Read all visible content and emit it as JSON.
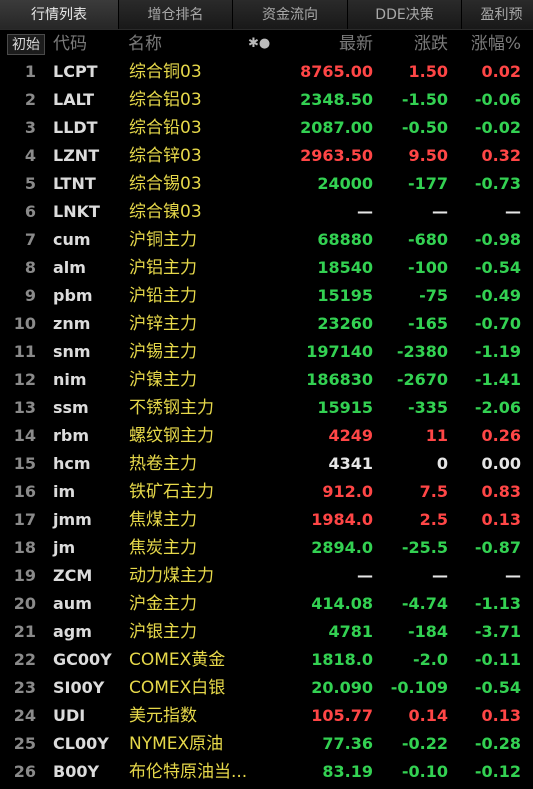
{
  "tabs": [
    "行情列表",
    "增仓排名",
    "资金流向",
    "DDE决策",
    "盈利预"
  ],
  "header": {
    "init_button": "初始",
    "code": "代码",
    "name": "名称",
    "icons": "✱●",
    "price": "最新",
    "change": "涨跌",
    "pct": "涨幅%"
  },
  "colors": {
    "up": "#ff4646",
    "down": "#33d152",
    "flat": "#e6e6e6",
    "name": "#e6d84a"
  },
  "rows": [
    {
      "no": "1",
      "code": "LCPT",
      "name": "综合铜03",
      "price": "8765.00",
      "change": "1.50",
      "pct": "0.02",
      "dir": "up"
    },
    {
      "no": "2",
      "code": "LALT",
      "name": "综合铝03",
      "price": "2348.50",
      "change": "-1.50",
      "pct": "-0.06",
      "dir": "down"
    },
    {
      "no": "3",
      "code": "LLDT",
      "name": "综合铅03",
      "price": "2087.00",
      "change": "-0.50",
      "pct": "-0.02",
      "dir": "down"
    },
    {
      "no": "4",
      "code": "LZNT",
      "name": "综合锌03",
      "price": "2963.50",
      "change": "9.50",
      "pct": "0.32",
      "dir": "up"
    },
    {
      "no": "5",
      "code": "LTNT",
      "name": "综合锡03",
      "price": "24000",
      "change": "-177",
      "pct": "-0.73",
      "dir": "down"
    },
    {
      "no": "6",
      "code": "LNKT",
      "name": "综合镍03",
      "price": "—",
      "change": "—",
      "pct": "—",
      "dir": "flat"
    },
    {
      "no": "7",
      "code": "cum",
      "name": "沪铜主力",
      "price": "68880",
      "change": "-680",
      "pct": "-0.98",
      "dir": "down"
    },
    {
      "no": "8",
      "code": "alm",
      "name": "沪铝主力",
      "price": "18540",
      "change": "-100",
      "pct": "-0.54",
      "dir": "down"
    },
    {
      "no": "9",
      "code": "pbm",
      "name": "沪铅主力",
      "price": "15195",
      "change": "-75",
      "pct": "-0.49",
      "dir": "down"
    },
    {
      "no": "10",
      "code": "znm",
      "name": "沪锌主力",
      "price": "23260",
      "change": "-165",
      "pct": "-0.70",
      "dir": "down"
    },
    {
      "no": "11",
      "code": "snm",
      "name": "沪锡主力",
      "price": "197140",
      "change": "-2380",
      "pct": "-1.19",
      "dir": "down"
    },
    {
      "no": "12",
      "code": "nim",
      "name": "沪镍主力",
      "price": "186830",
      "change": "-2670",
      "pct": "-1.41",
      "dir": "down"
    },
    {
      "no": "13",
      "code": "ssm",
      "name": "不锈钢主力",
      "price": "15915",
      "change": "-335",
      "pct": "-2.06",
      "dir": "down"
    },
    {
      "no": "14",
      "code": "rbm",
      "name": "螺纹钢主力",
      "price": "4249",
      "change": "11",
      "pct": "0.26",
      "dir": "up"
    },
    {
      "no": "15",
      "code": "hcm",
      "name": "热卷主力",
      "price": "4341",
      "change": "0",
      "pct": "0.00",
      "dir": "flat"
    },
    {
      "no": "16",
      "code": "im",
      "name": "铁矿石主力",
      "price": "912.0",
      "change": "7.5",
      "pct": "0.83",
      "dir": "up"
    },
    {
      "no": "17",
      "code": "jmm",
      "name": "焦煤主力",
      "price": "1984.0",
      "change": "2.5",
      "pct": "0.13",
      "dir": "up"
    },
    {
      "no": "18",
      "code": "jm",
      "name": "焦炭主力",
      "price": "2894.0",
      "change": "-25.5",
      "pct": "-0.87",
      "dir": "down"
    },
    {
      "no": "19",
      "code": "ZCM",
      "name": "动力煤主力",
      "price": "—",
      "change": "—",
      "pct": "—",
      "dir": "flat"
    },
    {
      "no": "20",
      "code": "aum",
      "name": "沪金主力",
      "price": "414.08",
      "change": "-4.74",
      "pct": "-1.13",
      "dir": "down"
    },
    {
      "no": "21",
      "code": "agm",
      "name": "沪银主力",
      "price": "4781",
      "change": "-184",
      "pct": "-3.71",
      "dir": "down"
    },
    {
      "no": "22",
      "code": "GC00Y",
      "name": "COMEX黄金",
      "price": "1818.0",
      "change": "-2.0",
      "pct": "-0.11",
      "dir": "down"
    },
    {
      "no": "23",
      "code": "SI00Y",
      "name": "COMEX白银",
      "price": "20.090",
      "change": "-0.109",
      "pct": "-0.54",
      "dir": "down"
    },
    {
      "no": "24",
      "code": "UDI",
      "name": "美元指数",
      "price": "105.77",
      "change": "0.14",
      "pct": "0.13",
      "dir": "up"
    },
    {
      "no": "25",
      "code": "CL00Y",
      "name": "NYMEX原油",
      "price": "77.36",
      "change": "-0.22",
      "pct": "-0.28",
      "dir": "down"
    },
    {
      "no": "26",
      "code": "B00Y",
      "name": "布伦特原油当...",
      "price": "83.19",
      "change": "-0.10",
      "pct": "-0.12",
      "dir": "down"
    }
  ]
}
